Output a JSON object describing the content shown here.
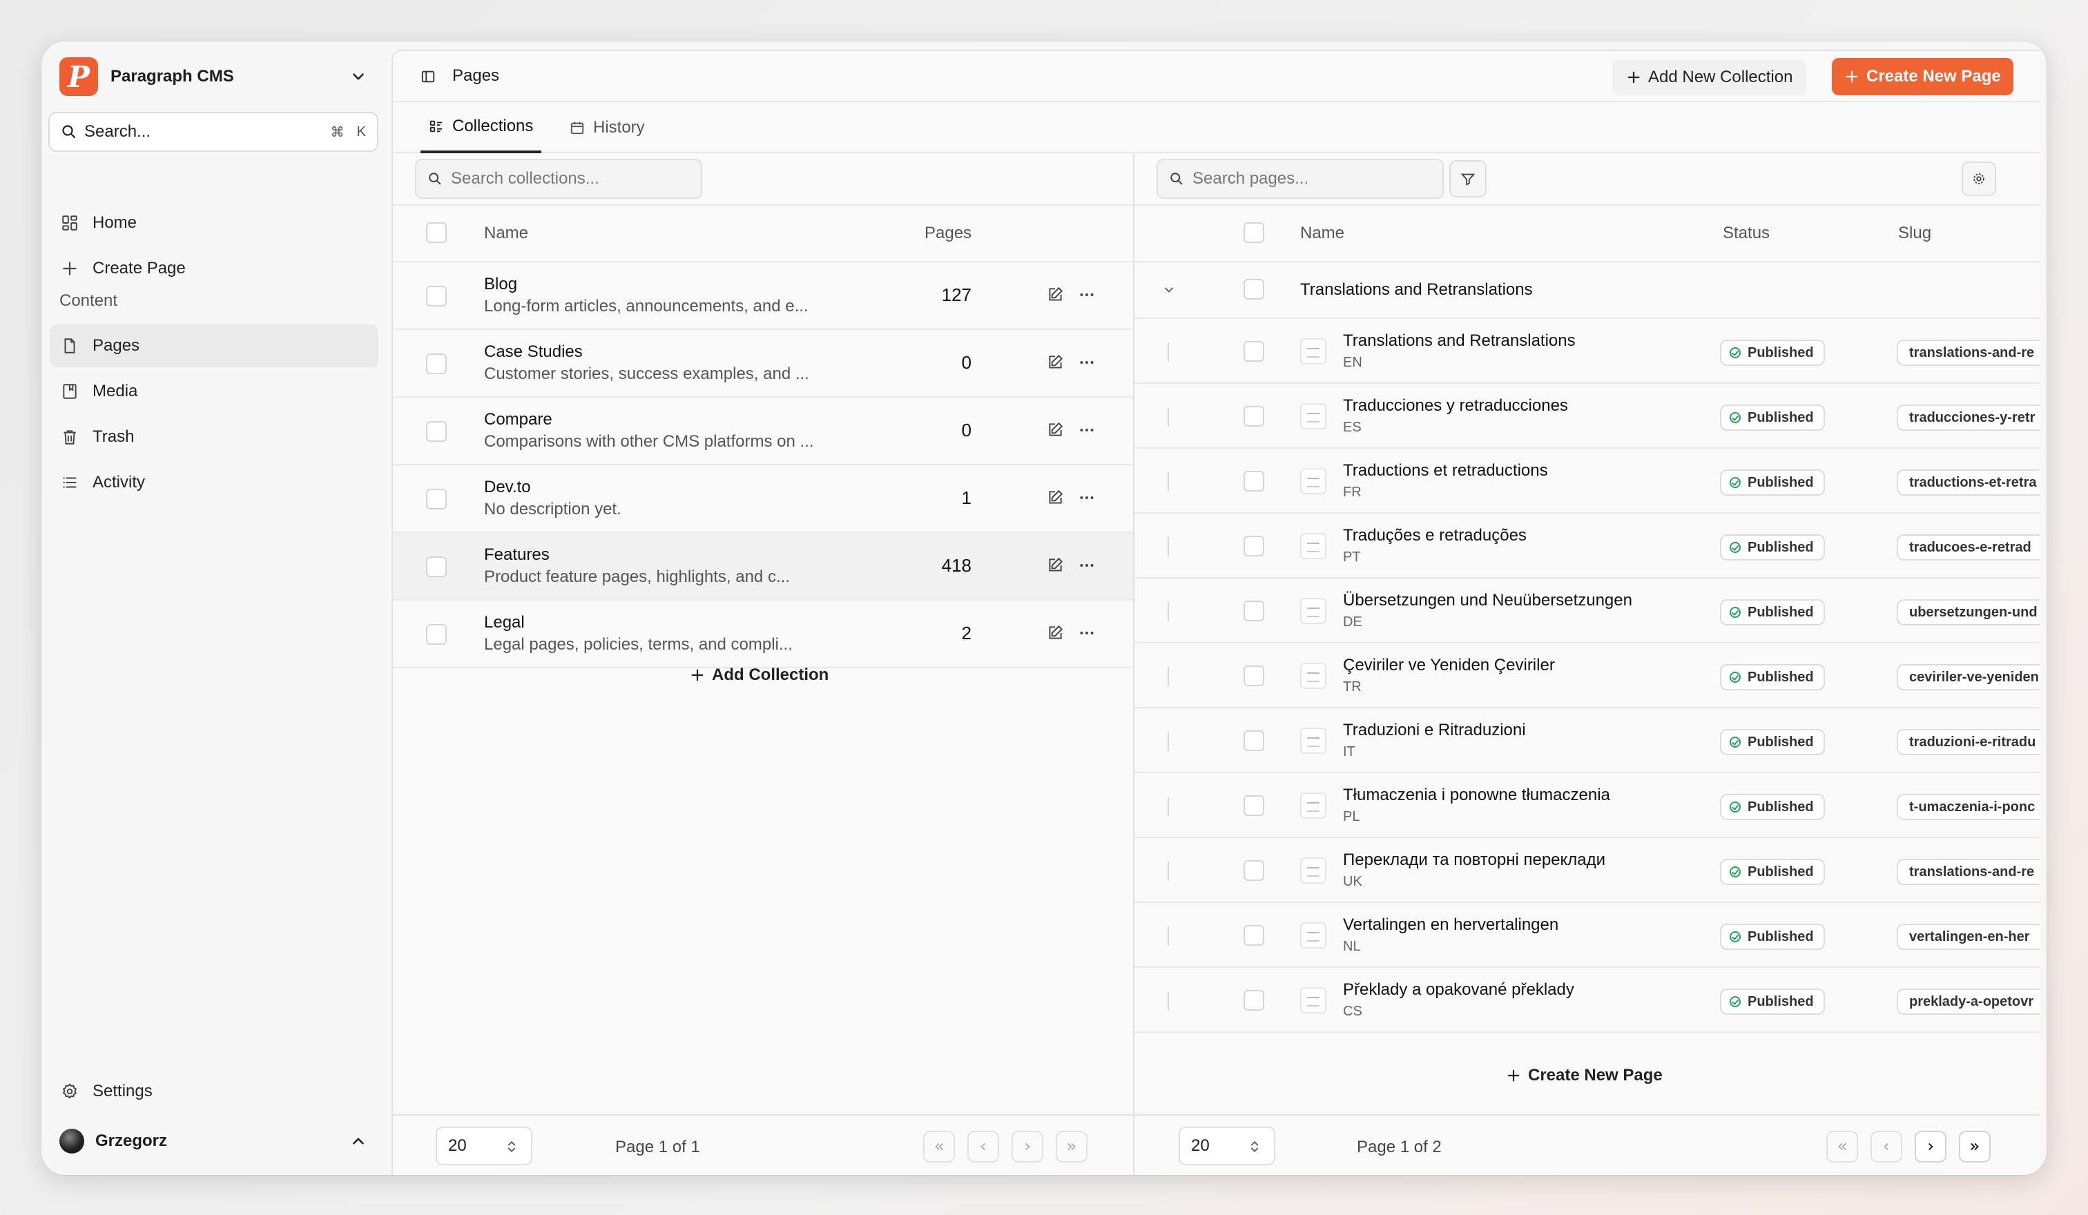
{
  "app": {
    "name": "Paragraph CMS",
    "logo_letter": "P"
  },
  "sidebar": {
    "search": {
      "label": "Search...",
      "shortcut_cmd": "⌘",
      "shortcut_key": "K"
    },
    "items": [
      {
        "label": "Home",
        "icon": "dashboard-icon"
      },
      {
        "label": "Create Page",
        "icon": "plus-icon"
      }
    ],
    "section_label": "Content",
    "content_items": [
      {
        "label": "Pages",
        "icon": "file-icon",
        "active": true
      },
      {
        "label": "Media",
        "icon": "image-icon"
      },
      {
        "label": "Trash",
        "icon": "trash-icon"
      },
      {
        "label": "Activity",
        "icon": "list-icon"
      }
    ],
    "settings_label": "Settings",
    "user": {
      "name": "Grzegorz"
    }
  },
  "header": {
    "title": "Pages",
    "add_collection_label": "Add New Collection",
    "create_page_label": "Create New Page",
    "accent_color": "#ee6433"
  },
  "tabs": [
    {
      "label": "Collections",
      "active": true
    },
    {
      "label": "History",
      "active": false
    }
  ],
  "collections": {
    "search_placeholder": "Search collections...",
    "columns": {
      "name": "Name",
      "pages": "Pages"
    },
    "rows": [
      {
        "name": "Blog",
        "description": "Long-form articles, announcements, and e...",
        "pages": "127"
      },
      {
        "name": "Case Studies",
        "description": "Customer stories, success examples, and ...",
        "pages": "0"
      },
      {
        "name": "Compare",
        "description": "Comparisons with other CMS platforms on ...",
        "pages": "0"
      },
      {
        "name": "Dev.to",
        "description": "No description yet.",
        "pages": "1"
      },
      {
        "name": "Features",
        "description": "Product feature pages, highlights, and c...",
        "pages": "418"
      },
      {
        "name": "Legal",
        "description": "Legal pages, policies, terms, and compli...",
        "pages": "2"
      }
    ],
    "add_label": "Add Collection",
    "pager": {
      "page_size": "20",
      "page_text": "Page 1 of 1"
    }
  },
  "pages": {
    "search_placeholder": "Search pages...",
    "columns": {
      "name": "Name",
      "status": "Status",
      "slug": "Slug"
    },
    "group_title": "Translations and Retranslations",
    "rows": [
      {
        "title": "Translations and Retranslations",
        "lang": "EN",
        "status": "Published",
        "slug": "translations-and-re"
      },
      {
        "title": "Traducciones y retraducciones",
        "lang": "ES",
        "status": "Published",
        "slug": "traducciones-y-retr"
      },
      {
        "title": "Traductions et retraductions",
        "lang": "FR",
        "status": "Published",
        "slug": "traductions-et-retra"
      },
      {
        "title": "Traduções e retraduções",
        "lang": "PT",
        "status": "Published",
        "slug": "traducoes-e-retrad"
      },
      {
        "title": "Übersetzungen und Neuübersetzungen",
        "lang": "DE",
        "status": "Published",
        "slug": "ubersetzungen-und"
      },
      {
        "title": "Çeviriler ve Yeniden Çeviriler",
        "lang": "TR",
        "status": "Published",
        "slug": "ceviriler-ve-yeniden"
      },
      {
        "title": "Traduzioni e Ritraduzioni",
        "lang": "IT",
        "status": "Published",
        "slug": "traduzioni-e-ritradu"
      },
      {
        "title": "Tłumaczenia i ponowne tłumaczenia",
        "lang": "PL",
        "status": "Published",
        "slug": "t-umaczenia-i-ponc"
      },
      {
        "title": "Переклади та повторні переклади",
        "lang": "UK",
        "status": "Published",
        "slug": "translations-and-re"
      },
      {
        "title": "Vertalingen en hervertalingen",
        "lang": "NL",
        "status": "Published",
        "slug": "vertalingen-en-her"
      },
      {
        "title": "Překlady a opakované překlady",
        "lang": "CS",
        "status": "Published",
        "slug": "preklady-a-opetovr"
      }
    ],
    "create_label": "Create New Page",
    "pager": {
      "page_size": "20",
      "page_text": "Page 1 of 2"
    }
  }
}
